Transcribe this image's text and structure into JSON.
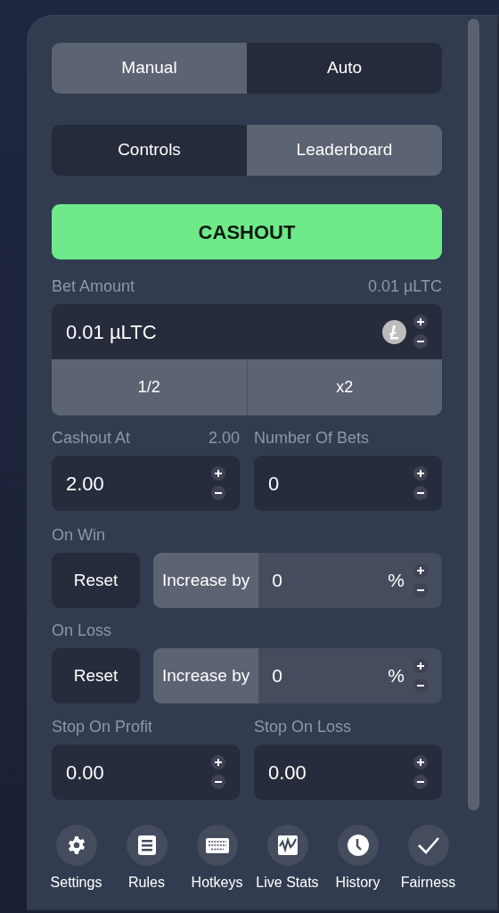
{
  "mode_tabs": [
    {
      "label": "Manual",
      "selected": true
    },
    {
      "label": "Auto",
      "selected": false
    }
  ],
  "view_tabs": [
    {
      "label": "Controls",
      "selected": false
    },
    {
      "label": "Leaderboard",
      "selected": true
    }
  ],
  "cashout_button": "CASHOUT",
  "bet_amount": {
    "label": "Bet Amount",
    "converted": "0.01 µLTC",
    "value": "0.01 µLTC",
    "buttons": [
      "1/2",
      "x2"
    ]
  },
  "cashout_at": {
    "label": "Cashout At",
    "reading": "2.00",
    "value": "2.00"
  },
  "number_of_bets": {
    "label": "Number Of Bets",
    "value": "0"
  },
  "on_win": {
    "label": "On Win",
    "reset": "Reset",
    "increase_label": "Increase by",
    "value": "0",
    "unit": "%"
  },
  "on_loss": {
    "label": "On Loss",
    "reset": "Reset",
    "increase_label": "Increase by",
    "value": "0",
    "unit": "%"
  },
  "stop_on_profit": {
    "label": "Stop On Profit",
    "value": "0.00"
  },
  "stop_on_loss": {
    "label": "Stop On Loss",
    "value": "0.00"
  },
  "footer": [
    {
      "label": "Settings",
      "kind": "settings"
    },
    {
      "label": "Rules",
      "kind": "rules"
    },
    {
      "label": "Hotkeys",
      "kind": "hotkeys"
    },
    {
      "label": "Live Stats",
      "kind": "stats"
    },
    {
      "label": "History",
      "kind": "history"
    },
    {
      "label": "Fairness",
      "kind": "fairness"
    }
  ]
}
